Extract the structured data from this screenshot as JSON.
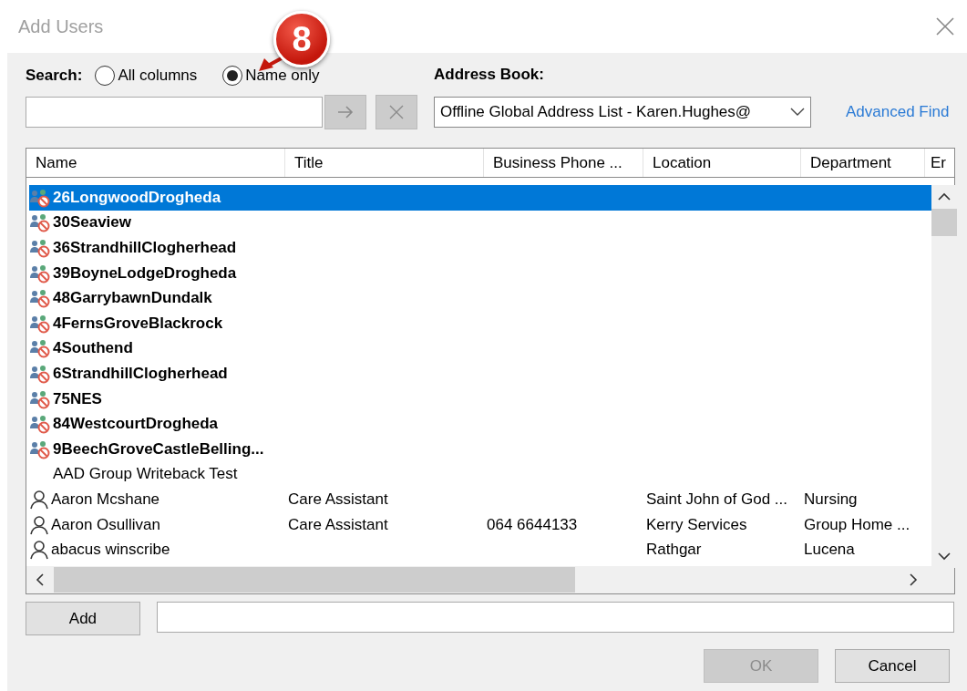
{
  "window": {
    "title": "Add Users"
  },
  "callout": {
    "number": "8"
  },
  "search": {
    "label": "Search:",
    "options": [
      {
        "label": "All columns",
        "selected": false
      },
      {
        "label": "Name only",
        "selected": true
      }
    ],
    "go_disabled": true,
    "clear_disabled": true
  },
  "address_book": {
    "label": "Address Book:",
    "value": "Offline Global Address List - Karen.Hughes@",
    "link": "Advanced Find"
  },
  "table": {
    "columns": [
      "Name",
      "Title",
      "Business Phone ...",
      "Location",
      "Department",
      "Er"
    ],
    "rows": [
      {
        "kind": "group",
        "selected": true,
        "name": "26LongwoodDrogheda"
      },
      {
        "kind": "group",
        "selected": false,
        "name": "30Seaview"
      },
      {
        "kind": "group",
        "selected": false,
        "name": "36StrandhillClogherhead"
      },
      {
        "kind": "group",
        "selected": false,
        "name": "39BoyneLodgeDrogheda"
      },
      {
        "kind": "group",
        "selected": false,
        "name": "48GarrybawnDundalk"
      },
      {
        "kind": "group",
        "selected": false,
        "name": "4FernsGroveBlackrock"
      },
      {
        "kind": "group",
        "selected": false,
        "name": "4Southend"
      },
      {
        "kind": "group",
        "selected": false,
        "name": "6StrandhillClogherhead"
      },
      {
        "kind": "group",
        "selected": false,
        "name": "75NES"
      },
      {
        "kind": "group",
        "selected": false,
        "name": "84WestcourtDrogheda"
      },
      {
        "kind": "group",
        "selected": false,
        "name": "9BeechGroveCastleBelling..."
      },
      {
        "kind": "plain",
        "selected": false,
        "name": "AAD Group Writeback Test"
      },
      {
        "kind": "user",
        "selected": false,
        "name": "Aaron Mcshane",
        "title": "Care Assistant",
        "location": "Saint John of God ...",
        "department": "Nursing"
      },
      {
        "kind": "user",
        "selected": false,
        "name": "Aaron Osullivan",
        "title": "Care Assistant",
        "phone": "064 6644133",
        "location": "Kerry Services",
        "department": "Group Home ..."
      },
      {
        "kind": "user",
        "selected": false,
        "name": "abacus winscribe",
        "location": "Rathgar",
        "department": "Lucena"
      }
    ]
  },
  "add": {
    "label": "Add"
  },
  "buttons": [
    {
      "label": "OK",
      "disabled": true
    },
    {
      "label": "Cancel",
      "disabled": false
    }
  ]
}
